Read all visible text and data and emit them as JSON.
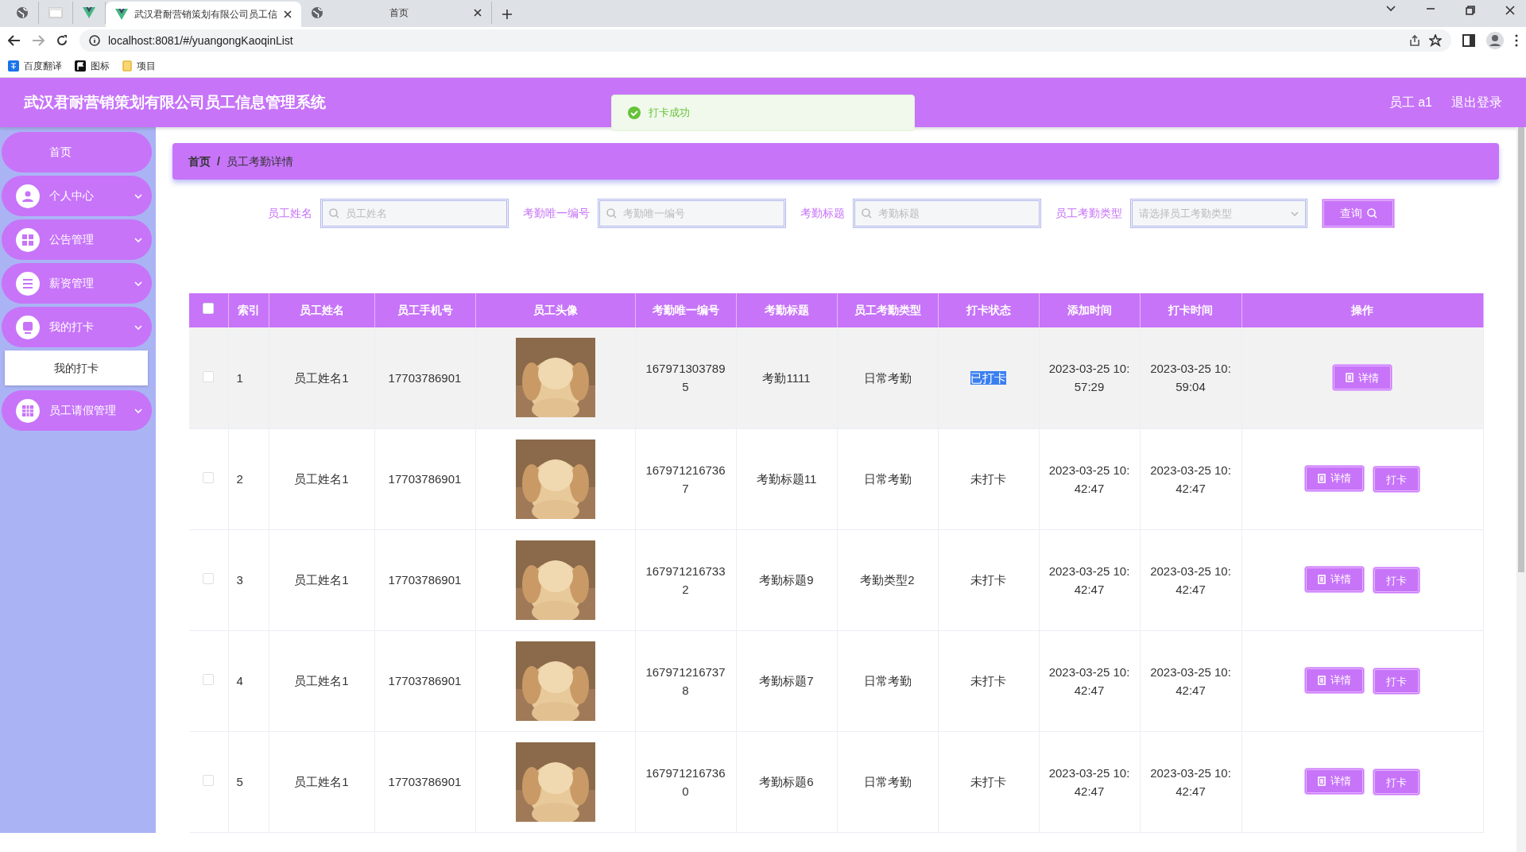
{
  "browser": {
    "tabs": [
      {
        "selected": false
      },
      {
        "selected": false
      },
      {
        "selected": false
      },
      {
        "title": "武汉君耐营销策划有限公司员工信",
        "selected": true
      },
      {
        "title": "首页",
        "selected": false
      }
    ],
    "address": "localhost:8081/#/yuangongKaoqinList",
    "bookmarks": [
      "百度翻译",
      "图标",
      "项目"
    ]
  },
  "header": {
    "title": "武汉君耐营销策划有限公司员工信息管理系统",
    "user": "员工 a1",
    "logout": "退出登录"
  },
  "toast": {
    "text": "打卡成功"
  },
  "sidebar": {
    "items": [
      {
        "label": "首页",
        "kind": "home"
      },
      {
        "label": "个人中心",
        "kind": "menu"
      },
      {
        "label": "公告管理",
        "kind": "menu"
      },
      {
        "label": "薪资管理",
        "kind": "menu"
      },
      {
        "label": "我的打卡",
        "kind": "menu",
        "children": [
          {
            "label": "我的打卡"
          }
        ]
      },
      {
        "label": "员工请假管理",
        "kind": "menu"
      }
    ]
  },
  "breadcrumb": {
    "items": [
      "首页",
      "员工考勤详情"
    ],
    "separator": "/"
  },
  "search": {
    "fields": [
      {
        "label": "员工姓名",
        "kind": "input",
        "placeholder": "员工姓名"
      },
      {
        "label": "考勤唯一编号",
        "kind": "input",
        "placeholder": "考勤唯一编号"
      },
      {
        "label": "考勤标题",
        "kind": "input",
        "placeholder": "考勤标题"
      },
      {
        "label": "员工考勤类型",
        "kind": "select",
        "placeholder": "请选择员工考勤类型"
      }
    ],
    "button": "查询"
  },
  "table": {
    "columns": [
      "索引",
      "员工姓名",
      "员工手机号",
      "员工头像",
      "考勤唯一编号",
      "考勤标题",
      "员工考勤类型",
      "打卡状态",
      "添加时间",
      "打卡时间",
      "操作"
    ],
    "all_checked": false,
    "rows": [
      {
        "checked": false,
        "hovered": true,
        "index": "1",
        "name": "员工姓名1",
        "phone": "17703786901",
        "avatar": {
          "kind": "picture"
        },
        "code": "1679713037895",
        "title": "考勤1111",
        "type": "日常考勤",
        "status": "已打卡",
        "status_highlighted": true,
        "added": "2023-03-25 10:57:29",
        "clocked": "2023-03-25 10:59:04",
        "actions": [
          "详情"
        ]
      },
      {
        "checked": false,
        "hovered": false,
        "index": "2",
        "name": "员工姓名1",
        "phone": "17703786901",
        "avatar": {
          "kind": "picture"
        },
        "code": "1679712167367",
        "title": "考勤标题11",
        "type": "日常考勤",
        "status": "未打卡",
        "status_highlighted": false,
        "added": "2023-03-25 10:42:47",
        "clocked": "2023-03-25 10:42:47",
        "actions": [
          "详情",
          "打卡"
        ]
      },
      {
        "checked": false,
        "hovered": false,
        "index": "3",
        "name": "员工姓名1",
        "phone": "17703786901",
        "avatar": {
          "kind": "picture"
        },
        "code": "1679712167332",
        "title": "考勤标题9",
        "type": "考勤类型2",
        "status": "未打卡",
        "status_highlighted": false,
        "added": "2023-03-25 10:42:47",
        "clocked": "2023-03-25 10:42:47",
        "actions": [
          "详情",
          "打卡"
        ]
      },
      {
        "checked": false,
        "hovered": false,
        "index": "4",
        "name": "员工姓名1",
        "phone": "17703786901",
        "avatar": {
          "kind": "picture"
        },
        "code": "1679712167378",
        "title": "考勤标题7",
        "type": "日常考勤",
        "status": "未打卡",
        "status_highlighted": false,
        "added": "2023-03-25 10:42:47",
        "clocked": "2023-03-25 10:42:47",
        "actions": [
          "详情",
          "打卡"
        ]
      },
      {
        "checked": false,
        "hovered": false,
        "index": "5",
        "name": "员工姓名1",
        "phone": "17703786901",
        "avatar": {
          "kind": "picture"
        },
        "code": "1679712167360",
        "title": "考勤标题6",
        "type": "日常考勤",
        "status": "未打卡",
        "status_highlighted": false,
        "added": "2023-03-25 10:42:47",
        "clocked": "2023-03-25 10:42:47",
        "actions": [
          "详情",
          "打卡"
        ]
      }
    ]
  }
}
